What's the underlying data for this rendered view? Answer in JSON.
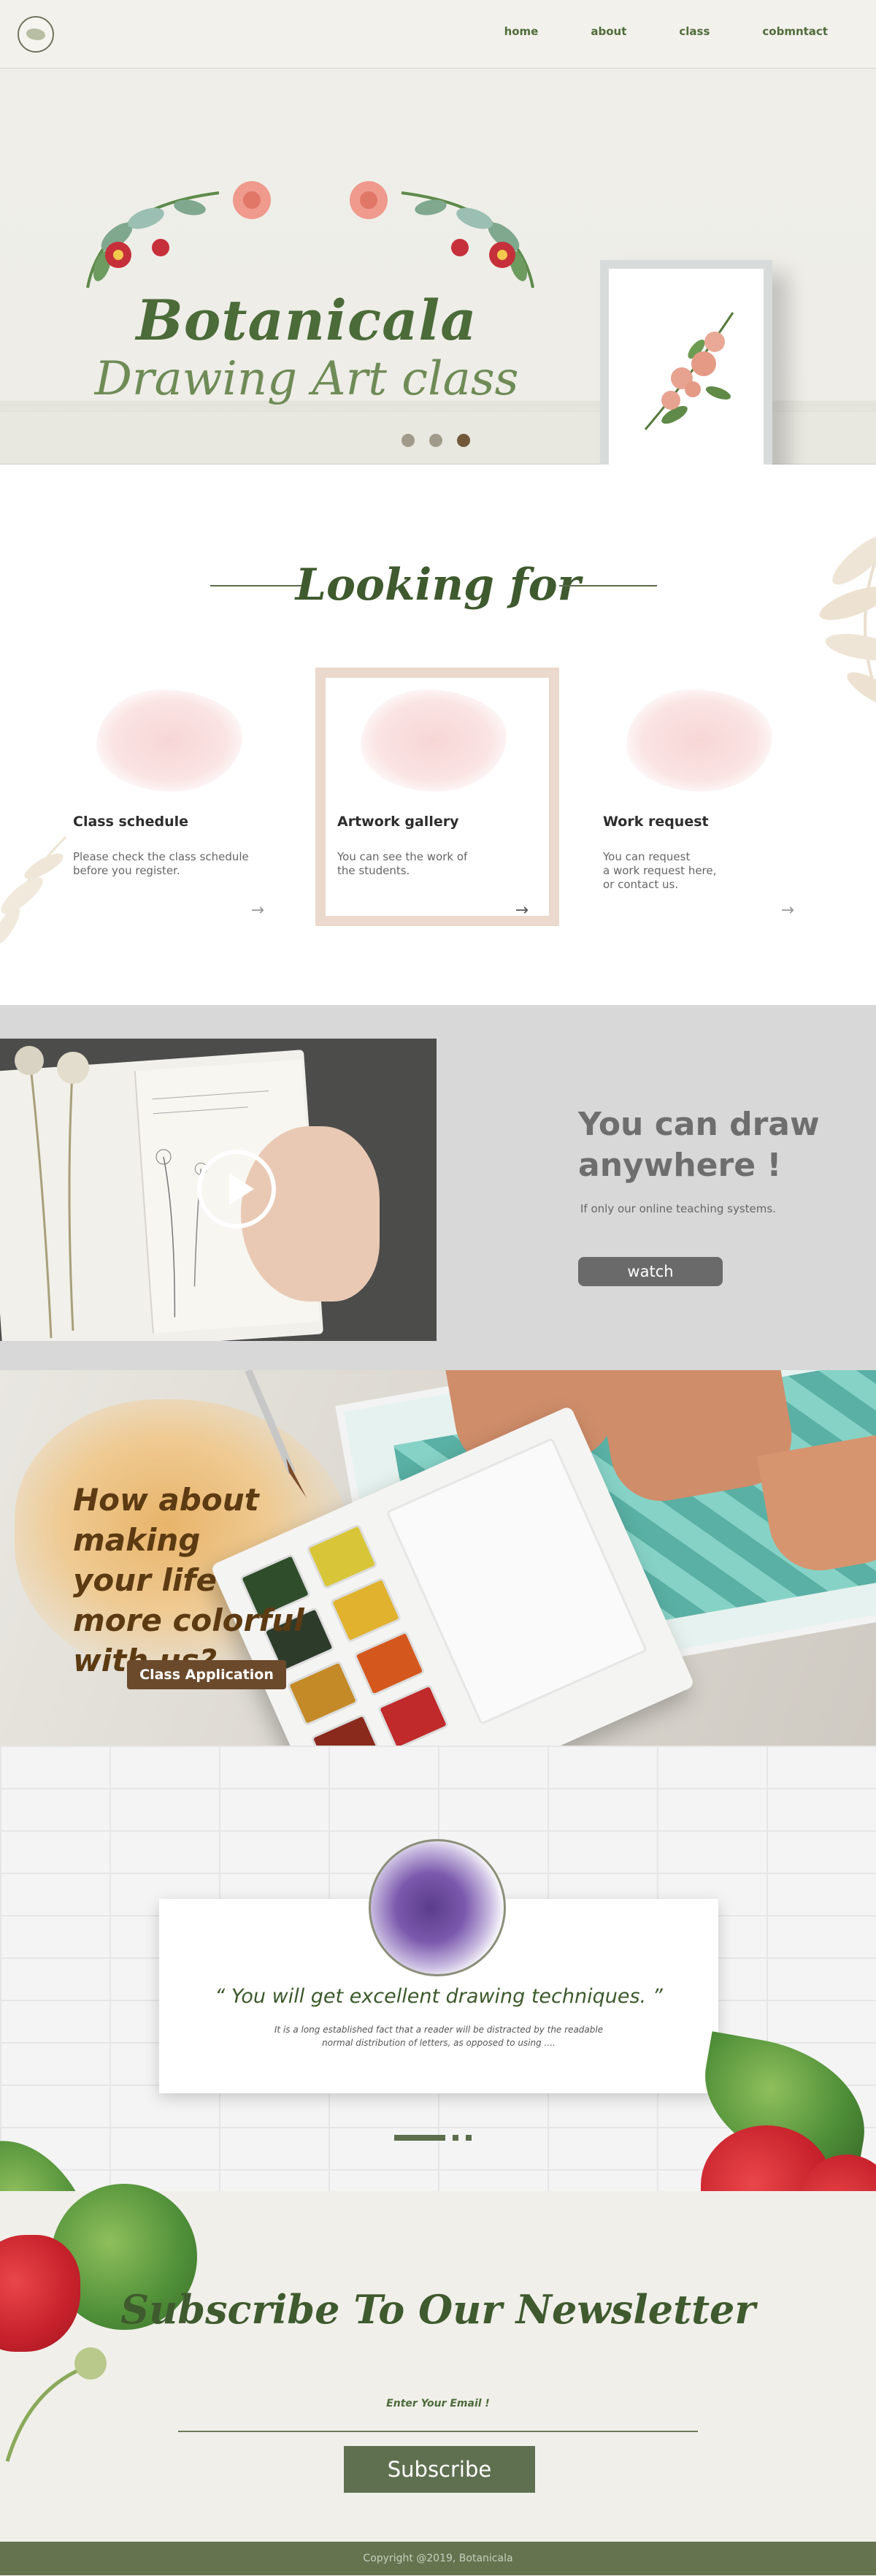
{
  "nav": {
    "links": [
      "home",
      "about",
      "class",
      "cobmntact"
    ]
  },
  "hero": {
    "title": "Botanicala",
    "subtitle": "Drawing Art class",
    "slides": 3,
    "active_slide": 3
  },
  "looking": {
    "title": "Looking for",
    "cards": [
      {
        "title": "Class schedule",
        "text": "Please check the class schedule\nbefore you register.",
        "arrow": "→"
      },
      {
        "title": "Artwork gallery",
        "text": "You can see the work of\nthe students.",
        "arrow": "→"
      },
      {
        "title": "Work request",
        "text": "You can request\na work request here,\nor contact us.",
        "arrow": "→"
      }
    ]
  },
  "video": {
    "heading": "You can draw anywhere !",
    "subtext": "If only our online teaching systems.",
    "button": "watch"
  },
  "cta": {
    "heading": "How about making\nyour life\nmore colorful\nwith us?",
    "button": "Class Application"
  },
  "testimonial": {
    "quote": "“ You will get excellent drawing techniques. ”",
    "body": "It is a long established fact that a reader will be distracted by the readable\nnormal distribution of letters, as opposed to using ....",
    "active_index": 1
  },
  "newsletter": {
    "title": "Subscribe To Our Newsletter",
    "email_label": "Enter Your Email !",
    "button": "Subscribe"
  },
  "footer": {
    "copyright": "Copyright @2019, Botanicala"
  },
  "colors": {
    "brand_green": "#4f6c3b",
    "footer_green": "#65744f",
    "cta_brown": "#5c3a12",
    "card_border": "#ead9cc"
  }
}
